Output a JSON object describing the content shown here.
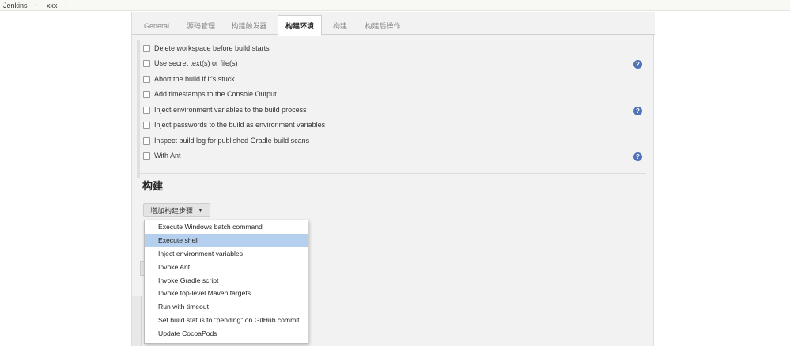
{
  "breadcrumb": {
    "items": [
      "Jenkins",
      "xxx"
    ],
    "separator": "›"
  },
  "tabs": [
    {
      "label": "General"
    },
    {
      "label": "源码管理"
    },
    {
      "label": "构建触发器"
    },
    {
      "label": "构建环境",
      "active": true
    },
    {
      "label": "构建"
    },
    {
      "label": "构建后操作"
    }
  ],
  "env_options": [
    {
      "label": "Delete workspace before build starts",
      "checked": false,
      "help": false
    },
    {
      "label": "Use secret text(s) or file(s)",
      "checked": false,
      "help": true
    },
    {
      "label": "Abort the build if it's stuck",
      "checked": false,
      "help": false
    },
    {
      "label": "Add timestamps to the Console Output",
      "checked": false,
      "help": false
    },
    {
      "label": "Inject environment variables to the build process",
      "checked": false,
      "help": true
    },
    {
      "label": "Inject passwords to the build as environment variables",
      "checked": false,
      "help": false
    },
    {
      "label": "Inspect build log for published Gradle build scans",
      "checked": false,
      "help": false
    },
    {
      "label": "With Ant",
      "checked": false,
      "help": true
    }
  ],
  "help_glyph": "?",
  "build_section": {
    "title": "构建",
    "add_step_label": "增加构建步骤",
    "caret": "▼"
  },
  "dropdown": {
    "items": [
      {
        "label": "Execute Windows batch command"
      },
      {
        "label": "Execute shell",
        "selected": true
      },
      {
        "label": "Inject environment variables"
      },
      {
        "label": "Invoke Ant"
      },
      {
        "label": "Invoke Gradle script"
      },
      {
        "label": "Invoke top-level Maven targets"
      },
      {
        "label": "Run with timeout"
      },
      {
        "label": "Set build status to \"pending\" on GitHub commit"
      },
      {
        "label": "Update CocoaPods"
      }
    ]
  },
  "colors": {
    "selected_item": "#b5d0ee",
    "help_icon": "#4f73b7",
    "panel_bg": "#f2f2f2"
  }
}
